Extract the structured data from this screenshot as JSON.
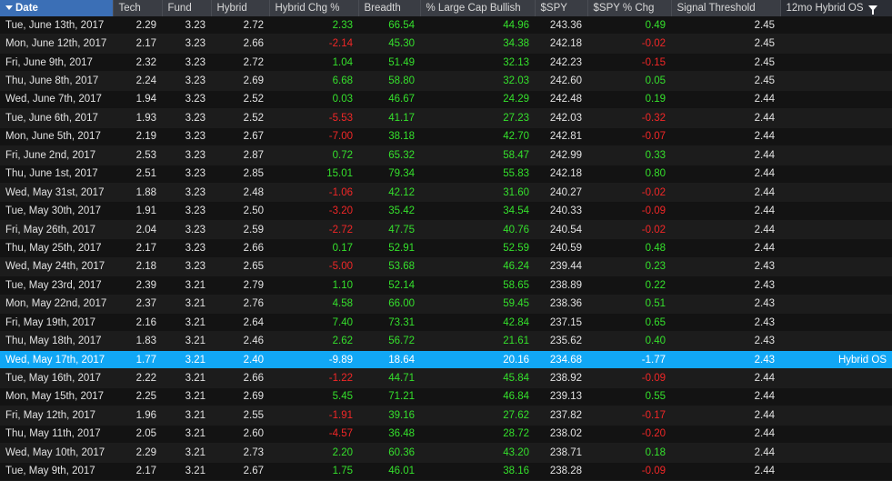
{
  "columns": [
    "Date",
    "Tech",
    "Fund",
    "Hybrid",
    "Hybrid Chg %",
    "Breadth",
    "% Large Cap Bullish",
    "$SPY",
    "$SPY % Chg",
    "Signal Threshold",
    "12mo Hybrid OS"
  ],
  "colors": {
    "positive": "#35e02c",
    "negative": "#f12727",
    "selected": "#11a7f5"
  },
  "rows": [
    {
      "date": "Tue, June 13th, 2017",
      "tech": "2.29",
      "fund": "3.23",
      "hybrid": "2.72",
      "hchg": "2.33",
      "breadth": "66.54",
      "lcb": "44.96",
      "spy": "243.36",
      "spychg": "0.49",
      "thresh": "2.45",
      "os": ""
    },
    {
      "date": "Mon, June 12th, 2017",
      "tech": "2.17",
      "fund": "3.23",
      "hybrid": "2.66",
      "hchg": "-2.14",
      "breadth": "45.30",
      "lcb": "34.38",
      "spy": "242.18",
      "spychg": "-0.02",
      "thresh": "2.45",
      "os": ""
    },
    {
      "date": "Fri, June 9th, 2017",
      "tech": "2.32",
      "fund": "3.23",
      "hybrid": "2.72",
      "hchg": "1.04",
      "breadth": "51.49",
      "lcb": "32.13",
      "spy": "242.23",
      "spychg": "-0.15",
      "thresh": "2.45",
      "os": ""
    },
    {
      "date": "Thu, June 8th, 2017",
      "tech": "2.24",
      "fund": "3.23",
      "hybrid": "2.69",
      "hchg": "6.68",
      "breadth": "58.80",
      "lcb": "32.03",
      "spy": "242.60",
      "spychg": "0.05",
      "thresh": "2.45",
      "os": ""
    },
    {
      "date": "Wed, June 7th, 2017",
      "tech": "1.94",
      "fund": "3.23",
      "hybrid": "2.52",
      "hchg": "0.03",
      "breadth": "46.67",
      "lcb": "24.29",
      "spy": "242.48",
      "spychg": "0.19",
      "thresh": "2.44",
      "os": ""
    },
    {
      "date": "Tue, June 6th, 2017",
      "tech": "1.93",
      "fund": "3.23",
      "hybrid": "2.52",
      "hchg": "-5.53",
      "breadth": "41.17",
      "lcb": "27.23",
      "spy": "242.03",
      "spychg": "-0.32",
      "thresh": "2.44",
      "os": ""
    },
    {
      "date": "Mon, June 5th, 2017",
      "tech": "2.19",
      "fund": "3.23",
      "hybrid": "2.67",
      "hchg": "-7.00",
      "breadth": "38.18",
      "lcb": "42.70",
      "spy": "242.81",
      "spychg": "-0.07",
      "thresh": "2.44",
      "os": ""
    },
    {
      "date": "Fri, June 2nd, 2017",
      "tech": "2.53",
      "fund": "3.23",
      "hybrid": "2.87",
      "hchg": "0.72",
      "breadth": "65.32",
      "lcb": "58.47",
      "spy": "242.99",
      "spychg": "0.33",
      "thresh": "2.44",
      "os": ""
    },
    {
      "date": "Thu, June 1st, 2017",
      "tech": "2.51",
      "fund": "3.23",
      "hybrid": "2.85",
      "hchg": "15.01",
      "breadth": "79.34",
      "lcb": "55.83",
      "spy": "242.18",
      "spychg": "0.80",
      "thresh": "2.44",
      "os": ""
    },
    {
      "date": "Wed, May 31st, 2017",
      "tech": "1.88",
      "fund": "3.23",
      "hybrid": "2.48",
      "hchg": "-1.06",
      "breadth": "42.12",
      "lcb": "31.60",
      "spy": "240.27",
      "spychg": "-0.02",
      "thresh": "2.44",
      "os": ""
    },
    {
      "date": "Tue, May 30th, 2017",
      "tech": "1.91",
      "fund": "3.23",
      "hybrid": "2.50",
      "hchg": "-3.20",
      "breadth": "35.42",
      "lcb": "34.54",
      "spy": "240.33",
      "spychg": "-0.09",
      "thresh": "2.44",
      "os": ""
    },
    {
      "date": "Fri, May 26th, 2017",
      "tech": "2.04",
      "fund": "3.23",
      "hybrid": "2.59",
      "hchg": "-2.72",
      "breadth": "47.75",
      "lcb": "40.76",
      "spy": "240.54",
      "spychg": "-0.02",
      "thresh": "2.44",
      "os": ""
    },
    {
      "date": "Thu, May 25th, 2017",
      "tech": "2.17",
      "fund": "3.23",
      "hybrid": "2.66",
      "hchg": "0.17",
      "breadth": "52.91",
      "lcb": "52.59",
      "spy": "240.59",
      "spychg": "0.48",
      "thresh": "2.44",
      "os": ""
    },
    {
      "date": "Wed, May 24th, 2017",
      "tech": "2.18",
      "fund": "3.23",
      "hybrid": "2.65",
      "hchg": "-5.00",
      "breadth": "53.68",
      "lcb": "46.24",
      "spy": "239.44",
      "spychg": "0.23",
      "thresh": "2.43",
      "os": ""
    },
    {
      "date": "Tue, May 23rd, 2017",
      "tech": "2.39",
      "fund": "3.21",
      "hybrid": "2.79",
      "hchg": "1.10",
      "breadth": "52.14",
      "lcb": "58.65",
      "spy": "238.89",
      "spychg": "0.22",
      "thresh": "2.43",
      "os": ""
    },
    {
      "date": "Mon, May 22nd, 2017",
      "tech": "2.37",
      "fund": "3.21",
      "hybrid": "2.76",
      "hchg": "4.58",
      "breadth": "66.00",
      "lcb": "59.45",
      "spy": "238.36",
      "spychg": "0.51",
      "thresh": "2.43",
      "os": ""
    },
    {
      "date": "Fri, May 19th, 2017",
      "tech": "2.16",
      "fund": "3.21",
      "hybrid": "2.64",
      "hchg": "7.40",
      "breadth": "73.31",
      "lcb": "42.84",
      "spy": "237.15",
      "spychg": "0.65",
      "thresh": "2.43",
      "os": ""
    },
    {
      "date": "Thu, May 18th, 2017",
      "tech": "1.83",
      "fund": "3.21",
      "hybrid": "2.46",
      "hchg": "2.62",
      "breadth": "56.72",
      "lcb": "21.61",
      "spy": "235.62",
      "spychg": "0.40",
      "thresh": "2.43",
      "os": ""
    },
    {
      "date": "Wed, May 17th, 2017",
      "tech": "1.77",
      "fund": "3.21",
      "hybrid": "2.40",
      "hchg": "-9.89",
      "breadth": "18.64",
      "lcb": "20.16",
      "spy": "234.68",
      "spychg": "-1.77",
      "thresh": "2.43",
      "os": "Hybrid OS",
      "selected": true
    },
    {
      "date": "Tue, May 16th, 2017",
      "tech": "2.22",
      "fund": "3.21",
      "hybrid": "2.66",
      "hchg": "-1.22",
      "breadth": "44.71",
      "lcb": "45.84",
      "spy": "238.92",
      "spychg": "-0.09",
      "thresh": "2.44",
      "os": ""
    },
    {
      "date": "Mon, May 15th, 2017",
      "tech": "2.25",
      "fund": "3.21",
      "hybrid": "2.69",
      "hchg": "5.45",
      "breadth": "71.21",
      "lcb": "46.84",
      "spy": "239.13",
      "spychg": "0.55",
      "thresh": "2.44",
      "os": ""
    },
    {
      "date": "Fri, May 12th, 2017",
      "tech": "1.96",
      "fund": "3.21",
      "hybrid": "2.55",
      "hchg": "-1.91",
      "breadth": "39.16",
      "lcb": "27.62",
      "spy": "237.82",
      "spychg": "-0.17",
      "thresh": "2.44",
      "os": ""
    },
    {
      "date": "Thu, May 11th, 2017",
      "tech": "2.05",
      "fund": "3.21",
      "hybrid": "2.60",
      "hchg": "-4.57",
      "breadth": "36.48",
      "lcb": "28.72",
      "spy": "238.02",
      "spychg": "-0.20",
      "thresh": "2.44",
      "os": ""
    },
    {
      "date": "Wed, May 10th, 2017",
      "tech": "2.29",
      "fund": "3.21",
      "hybrid": "2.73",
      "hchg": "2.20",
      "breadth": "60.36",
      "lcb": "43.20",
      "spy": "238.71",
      "spychg": "0.18",
      "thresh": "2.44",
      "os": ""
    },
    {
      "date": "Tue, May 9th, 2017",
      "tech": "2.17",
      "fund": "3.21",
      "hybrid": "2.67",
      "hchg": "1.75",
      "breadth": "46.01",
      "lcb": "38.16",
      "spy": "238.28",
      "spychg": "-0.09",
      "thresh": "2.44",
      "os": ""
    }
  ]
}
